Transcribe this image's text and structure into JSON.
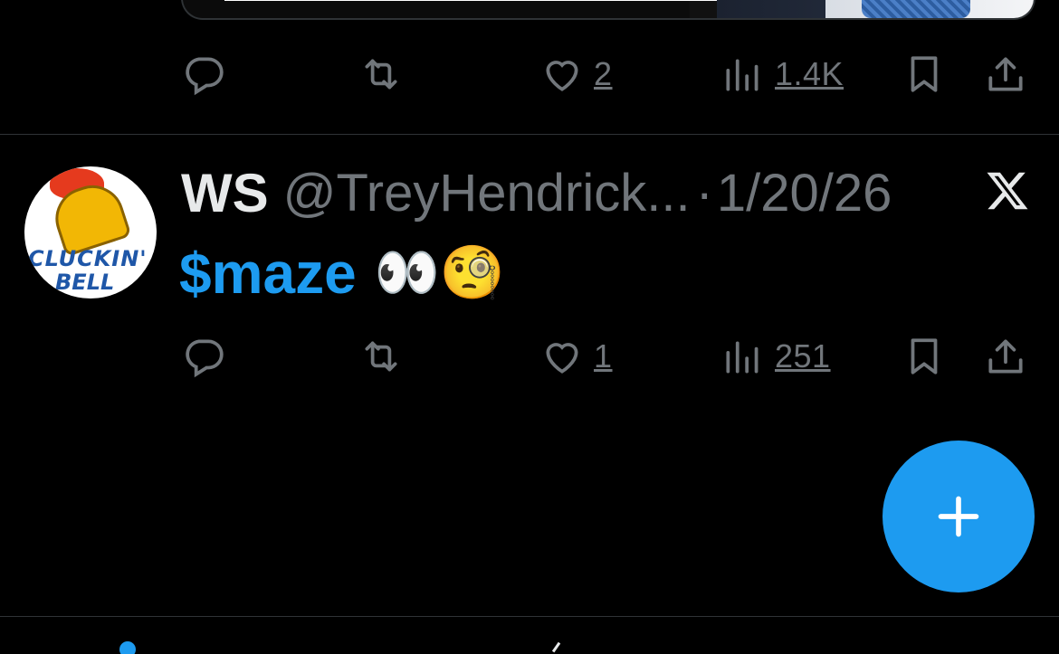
{
  "previous_tweet": {
    "actions": {
      "likes": "2",
      "views": "1.4K"
    }
  },
  "tweet": {
    "display_name": "WS",
    "handle": "@TreyHendrick...",
    "separator": "·",
    "date": "1/20/26",
    "cashtag": "$maze",
    "emoji_text": "👀🧐",
    "avatar_text_line1": "CLUCKIN'",
    "avatar_text_line2": "BELL",
    "actions": {
      "likes": "1",
      "views": "251"
    }
  },
  "fab": {
    "icon": "plus-icon"
  },
  "colors": {
    "background": "#000000",
    "accent": "#1d9bf0",
    "muted": "#71767b",
    "text": "#e7e9ea",
    "divider": "#2f3336"
  }
}
